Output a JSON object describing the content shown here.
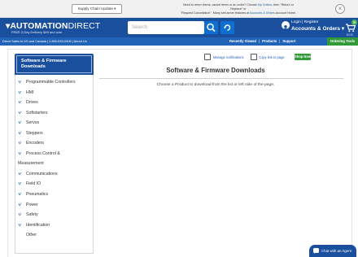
{
  "topbar": {
    "supply_chain_button": "Supply Chain Update",
    "notice_line1_a": "Need to return items, cancel items or an order? Choose",
    "notice_line1_link": "My Orders",
    "notice_line1_b": ", then \"Return or Replace\" or",
    "notice_line2_a": "\"Request Cancellation\". Many self-serve features at",
    "notice_line2_link": "Accounts & Orders",
    "notice_line2_b": "Account Home."
  },
  "header": {
    "logo_main": "AUTOMATION",
    "logo_light": "DIRECT",
    "tagline": "FREE 2-Day Delivery $49 and over",
    "search_placeholder": "Search",
    "login_label": "Login | Register",
    "accounts_label": "Accounts & Orders",
    "cart_count": "0",
    "cart_total": "$0.00"
  },
  "nav": {
    "left_text": "Direct Sales in US and Canada  |  1-800-633-0405  |  About Us",
    "recently_viewed": "Recently Viewed",
    "products": "Products",
    "support": "Support",
    "ordering_tools": "Ordering Tools"
  },
  "sidebar": {
    "title": "Software & Firmware Downloads",
    "items": [
      "Programmable Controllers",
      "HMI",
      "Drives",
      "Softstarters",
      "Servos",
      "Steppers",
      "Encoders",
      "Process Control &",
      "Communications",
      "Field IO",
      "Pneumatics",
      "Power",
      "Safety",
      "Identification"
    ],
    "continuation": "Measurement",
    "other": "Other"
  },
  "main": {
    "manage_notifications": "Manage notifications",
    "copy_link": "Copy link to page",
    "shop_now": "Shop Now",
    "title": "Software & Firmware Downloads",
    "description": "Choose a Product to download from the list or left side of the page."
  },
  "chat": {
    "label": "Chat with an Agent"
  },
  "colors": {
    "brand_blue": "#1a4f9e",
    "nav_blue": "#2063b7",
    "accent_green": "#2f9a37"
  }
}
